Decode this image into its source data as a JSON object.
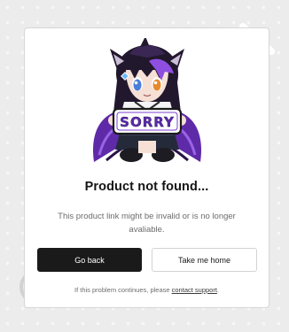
{
  "error_card": {
    "mascot_sign_text": "SORRY",
    "title": "Product not found...",
    "description": "This product link might be invalid or is no longer avaliable.",
    "primary_button_label": "Go back",
    "secondary_button_label": "Take me home",
    "footer_prefix": "If this problem continues, please ",
    "footer_link_label": "contact support",
    "footer_suffix": "."
  },
  "colors": {
    "primary_button": "#1a1a1a",
    "mascot_purple": "#7b3fd0",
    "page_background": "#ececec"
  },
  "icons": {
    "background_left": "x-circle-icon",
    "background_right": "crossed-lines-icon"
  }
}
